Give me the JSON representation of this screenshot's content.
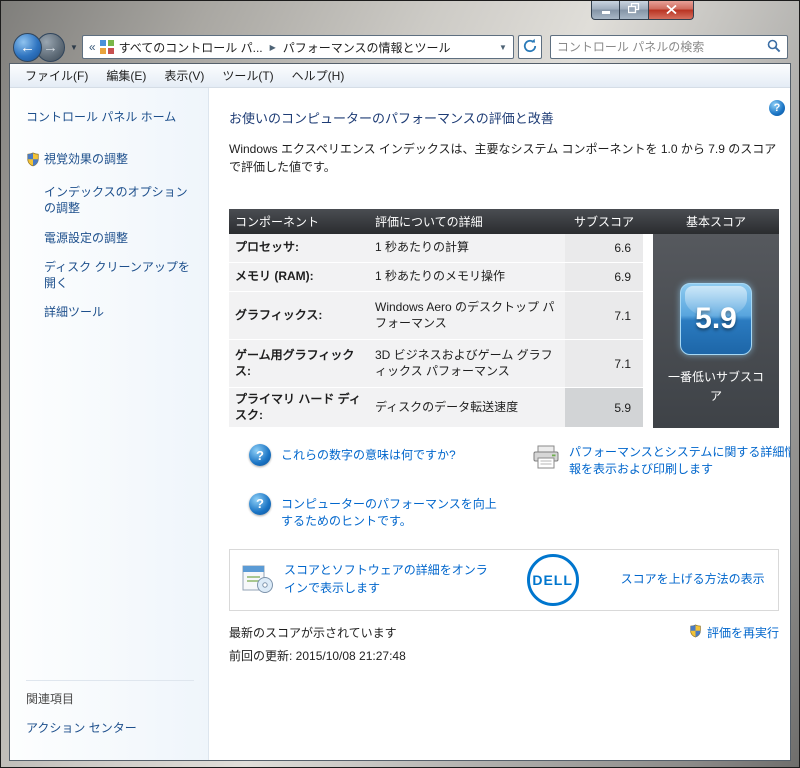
{
  "window": {
    "breadcrumb": {
      "root": "すべてのコントロール パ...",
      "current": "パフォーマンスの情報とツール"
    },
    "search": {
      "placeholder": "コントロール パネルの検索"
    }
  },
  "menubar": {
    "items": [
      "ファイル(F)",
      "編集(E)",
      "表示(V)",
      "ツール(T)",
      "ヘルプ(H)"
    ]
  },
  "sidebar": {
    "home": "コントロール パネル ホーム",
    "tasks": [
      {
        "label": "視覚効果の調整"
      },
      {
        "label": "インデックスのオプションの調整"
      },
      {
        "label": "電源設定の調整"
      },
      {
        "label": "ディスク クリーンアップを開く"
      },
      {
        "label": "詳細ツール"
      }
    ],
    "related_header": "関連項目",
    "related_items": [
      "アクション センター"
    ]
  },
  "main": {
    "title": "お使いのコンピューターのパフォーマンスの評価と改善",
    "description": "Windows エクスペリエンス インデックスは、主要なシステム コンポーネントを 1.0 から 7.9 のスコアで評価した値です。",
    "table": {
      "headers": [
        "コンポーネント",
        "評価についての詳細",
        "サブスコア",
        "基本スコア"
      ],
      "rows": [
        {
          "component": "プロセッサ:",
          "detail": "1 秒あたりの計算",
          "score": "6.6"
        },
        {
          "component": "メモリ (RAM):",
          "detail": "1 秒あたりのメモリ操作",
          "score": "6.9"
        },
        {
          "component": "グラフィックス:",
          "detail": "Windows Aero のデスクトップ パフォーマンス",
          "score": "7.1"
        },
        {
          "component": "ゲーム用グラフィックス:",
          "detail": "3D ビジネスおよびゲーム グラフィックス パフォーマンス",
          "score": "7.1"
        },
        {
          "component": "プライマリ ハード ディスク:",
          "detail": "ディスクのデータ転送速度",
          "score": "5.9"
        }
      ],
      "base_score": "5.9",
      "base_score_caption": "一番低いサブスコア"
    },
    "links": {
      "meaning": "これらの数字の意味は何ですか?",
      "tips": "コンピューターのパフォーマンスを向上するためのヒントです。",
      "print_details": "パフォーマンスとシステムに関する詳細情報を表示および印刷します"
    },
    "partner_box": {
      "online_details": "スコアとソフトウェアの詳細をオンラインで表示します",
      "brand": "DELL",
      "improve": "スコアを上げる方法の表示"
    },
    "status": {
      "latest": "最新のスコアが示されています",
      "last_update": "前回の更新: 2015/10/08 21:27:48",
      "rerun": "評価を再実行"
    }
  },
  "icons": {
    "back_arrow": "←",
    "forward_arrow": "→",
    "dropdown": "▼",
    "overflow": "«",
    "crumb_separator": "▶",
    "question": "?"
  },
  "colors": {
    "link": "#0066cc",
    "title": "#1e3c75",
    "badge_blue": "#2b7bc0",
    "base_panel": "#46494e",
    "table_header": "#3a3d41",
    "brand_blue": "#0076ce"
  }
}
